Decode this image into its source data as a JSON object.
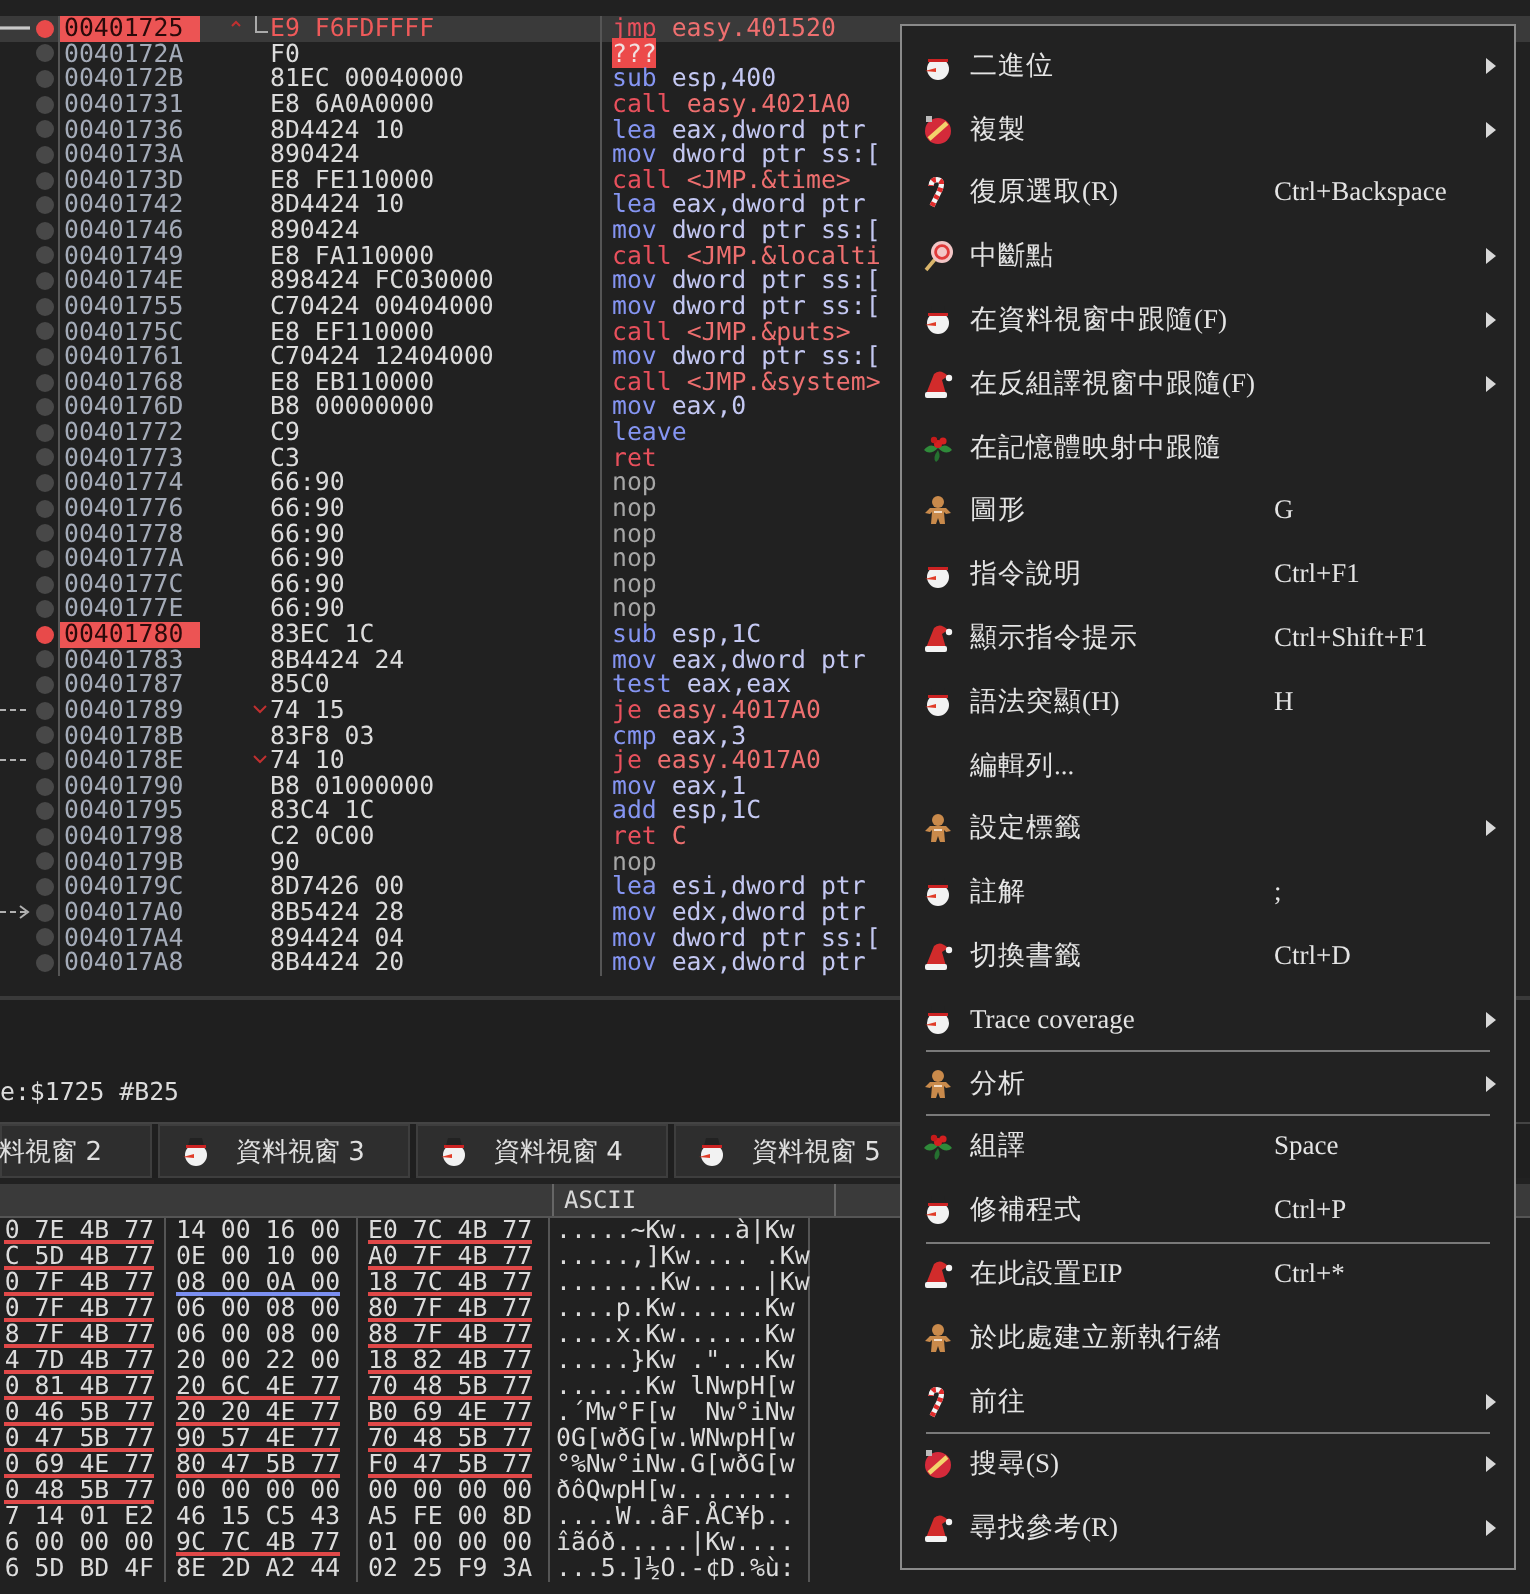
{
  "disassembly": {
    "rows": [
      {
        "address": "00401725",
        "bytes": "E9 F6FDFFFF",
        "mnemonic": "jmp",
        "operands": "easy.401520",
        "kind": "jump",
        "breakpoint": true,
        "selected": true,
        "patched": true,
        "jump_source": true,
        "jump_backward": true,
        "jump_target": false
      },
      {
        "address": "0040172A",
        "bytes": "F0",
        "mnemonic": "???",
        "kind": "invalid",
        "breakpoint": false,
        "selected": false,
        "patched": false,
        "jump_source": false,
        "jump_target": false
      },
      {
        "address": "0040172B",
        "bytes": "81EC 00040000",
        "mnemonic": "sub",
        "operands": "esp,400",
        "kind": "normal",
        "breakpoint": false,
        "selected": false,
        "patched": false,
        "jump_source": false,
        "jump_target": false
      },
      {
        "address": "00401731",
        "bytes": "E8 6A0A0000",
        "mnemonic": "call",
        "operands": "easy.4021A0",
        "kind": "call",
        "breakpoint": false,
        "selected": false,
        "patched": false,
        "jump_source": false,
        "jump_target": false
      },
      {
        "address": "00401736",
        "bytes": "8D4424 10",
        "mnemonic": "lea",
        "operands": "eax,dword ptr",
        "kind": "normal",
        "breakpoint": false,
        "selected": false,
        "patched": false,
        "jump_source": false,
        "jump_target": false
      },
      {
        "address": "0040173A",
        "bytes": "890424",
        "mnemonic": "mov",
        "operands": "dword ptr ss:[",
        "kind": "normal",
        "breakpoint": false,
        "selected": false,
        "patched": false,
        "jump_source": false,
        "jump_target": false
      },
      {
        "address": "0040173D",
        "bytes": "E8 FE110000",
        "mnemonic": "call",
        "operands": "<JMP.&time>",
        "kind": "call",
        "breakpoint": false,
        "selected": false,
        "patched": false,
        "jump_source": false,
        "jump_target": false
      },
      {
        "address": "00401742",
        "bytes": "8D4424 10",
        "mnemonic": "lea",
        "operands": "eax,dword ptr",
        "kind": "normal",
        "breakpoint": false,
        "selected": false,
        "patched": false,
        "jump_source": false,
        "jump_target": false
      },
      {
        "address": "00401746",
        "bytes": "890424",
        "mnemonic": "mov",
        "operands": "dword ptr ss:[",
        "kind": "normal",
        "breakpoint": false,
        "selected": false,
        "patched": false,
        "jump_source": false,
        "jump_target": false
      },
      {
        "address": "00401749",
        "bytes": "E8 FA110000",
        "mnemonic": "call",
        "operands": "<JMP.&localti",
        "kind": "call",
        "breakpoint": false,
        "selected": false,
        "patched": false,
        "jump_source": false,
        "jump_target": false
      },
      {
        "address": "0040174E",
        "bytes": "898424 FC030000",
        "mnemonic": "mov",
        "operands": "dword ptr ss:[",
        "kind": "normal",
        "breakpoint": false,
        "selected": false,
        "patched": false,
        "jump_source": false,
        "jump_target": false
      },
      {
        "address": "00401755",
        "bytes": "C70424 00404000",
        "mnemonic": "mov",
        "operands": "dword ptr ss:[",
        "kind": "normal",
        "breakpoint": false,
        "selected": false,
        "patched": false,
        "jump_source": false,
        "jump_target": false
      },
      {
        "address": "0040175C",
        "bytes": "E8 EF110000",
        "mnemonic": "call",
        "operands": "<JMP.&puts>",
        "kind": "call",
        "breakpoint": false,
        "selected": false,
        "patched": false,
        "jump_source": false,
        "jump_target": false
      },
      {
        "address": "00401761",
        "bytes": "C70424 12404000",
        "mnemonic": "mov",
        "operands": "dword ptr ss:[",
        "kind": "normal",
        "breakpoint": false,
        "selected": false,
        "patched": false,
        "jump_source": false,
        "jump_target": false
      },
      {
        "address": "00401768",
        "bytes": "E8 EB110000",
        "mnemonic": "call",
        "operands": "<JMP.&system>",
        "kind": "call",
        "breakpoint": false,
        "selected": false,
        "patched": false,
        "jump_source": false,
        "jump_target": false
      },
      {
        "address": "0040176D",
        "bytes": "B8 00000000",
        "mnemonic": "mov",
        "operands": "eax,0",
        "kind": "normal",
        "breakpoint": false,
        "selected": false,
        "patched": false,
        "jump_source": false,
        "jump_target": false
      },
      {
        "address": "00401772",
        "bytes": "C9",
        "mnemonic": "leave",
        "kind": "normal",
        "breakpoint": false,
        "selected": false,
        "patched": false,
        "jump_source": false,
        "jump_target": false
      },
      {
        "address": "00401773",
        "bytes": "C3",
        "mnemonic": "ret",
        "kind": "ret",
        "breakpoint": false,
        "selected": false,
        "patched": false,
        "jump_source": false,
        "jump_target": false
      },
      {
        "address": "00401774",
        "bytes": "66:90",
        "mnemonic": "nop",
        "kind": "nop",
        "breakpoint": false,
        "selected": false,
        "patched": false,
        "jump_source": false,
        "jump_target": false
      },
      {
        "address": "00401776",
        "bytes": "66:90",
        "mnemonic": "nop",
        "kind": "nop",
        "breakpoint": false,
        "selected": false,
        "patched": false,
        "jump_source": false,
        "jump_target": false
      },
      {
        "address": "00401778",
        "bytes": "66:90",
        "mnemonic": "nop",
        "kind": "nop",
        "breakpoint": false,
        "selected": false,
        "patched": false,
        "jump_source": false,
        "jump_target": false
      },
      {
        "address": "0040177A",
        "bytes": "66:90",
        "mnemonic": "nop",
        "kind": "nop",
        "breakpoint": false,
        "selected": false,
        "patched": false,
        "jump_source": false,
        "jump_target": false
      },
      {
        "address": "0040177C",
        "bytes": "66:90",
        "mnemonic": "nop",
        "kind": "nop",
        "breakpoint": false,
        "selected": false,
        "patched": false,
        "jump_source": false,
        "jump_target": false
      },
      {
        "address": "0040177E",
        "bytes": "66:90",
        "mnemonic": "nop",
        "kind": "nop",
        "breakpoint": false,
        "selected": false,
        "patched": false,
        "jump_source": false,
        "jump_target": false
      },
      {
        "address": "00401780",
        "bytes": "83EC 1C",
        "mnemonic": "sub",
        "operands": "esp,1C",
        "kind": "normal",
        "breakpoint": true,
        "selected": false,
        "patched": false,
        "jump_source": false,
        "jump_target": false
      },
      {
        "address": "00401783",
        "bytes": "8B4424 24",
        "mnemonic": "mov",
        "operands": "eax,dword ptr",
        "kind": "normal",
        "breakpoint": false,
        "selected": false,
        "patched": false,
        "jump_source": false,
        "jump_target": false
      },
      {
        "address": "00401787",
        "bytes": "85C0",
        "mnemonic": "test",
        "operands": "eax,eax",
        "kind": "normal",
        "breakpoint": false,
        "selected": false,
        "patched": false,
        "jump_source": false,
        "jump_target": false
      },
      {
        "address": "00401789",
        "bytes": "74 15",
        "mnemonic": "je",
        "operands": "easy.4017A0",
        "kind": "jump",
        "breakpoint": false,
        "selected": false,
        "patched": false,
        "jump_source": true,
        "jump_backward": false,
        "jump_target": false
      },
      {
        "address": "0040178B",
        "bytes": "83F8 03",
        "mnemonic": "cmp",
        "operands": "eax,3",
        "kind": "normal",
        "breakpoint": false,
        "selected": false,
        "patched": false,
        "jump_source": false,
        "jump_target": false
      },
      {
        "address": "0040178E",
        "bytes": "74 10",
        "mnemonic": "je",
        "operands": "easy.4017A0",
        "kind": "jump",
        "breakpoint": false,
        "selected": false,
        "patched": false,
        "jump_source": true,
        "jump_backward": false,
        "jump_target": false
      },
      {
        "address": "00401790",
        "bytes": "B8 01000000",
        "mnemonic": "mov",
        "operands": "eax,1",
        "kind": "normal",
        "breakpoint": false,
        "selected": false,
        "patched": false,
        "jump_source": false,
        "jump_target": false
      },
      {
        "address": "00401795",
        "bytes": "83C4 1C",
        "mnemonic": "add",
        "operands": "esp,1C",
        "kind": "normal",
        "breakpoint": false,
        "selected": false,
        "patched": false,
        "jump_source": false,
        "jump_target": false
      },
      {
        "address": "00401798",
        "bytes": "C2 0C00",
        "mnemonic": "ret",
        "operands": "C",
        "kind": "ret",
        "breakpoint": false,
        "selected": false,
        "patched": false,
        "jump_source": false,
        "jump_target": false
      },
      {
        "address": "0040179B",
        "bytes": "90",
        "mnemonic": "nop",
        "kind": "nop",
        "breakpoint": false,
        "selected": false,
        "patched": false,
        "jump_source": false,
        "jump_target": false
      },
      {
        "address": "0040179C",
        "bytes": "8D7426 00",
        "mnemonic": "lea",
        "operands": "esi,dword ptr",
        "kind": "normal",
        "breakpoint": false,
        "selected": false,
        "patched": false,
        "jump_source": false,
        "jump_target": false
      },
      {
        "address": "004017A0",
        "bytes": "8B5424 28",
        "mnemonic": "mov",
        "operands": "edx,dword ptr",
        "kind": "normal",
        "breakpoint": false,
        "selected": false,
        "patched": false,
        "jump_source": false,
        "jump_target": true
      },
      {
        "address": "004017A4",
        "bytes": "894424 04",
        "mnemonic": "mov",
        "operands": "dword ptr ss:[",
        "kind": "normal",
        "breakpoint": false,
        "selected": false,
        "patched": false,
        "jump_source": false,
        "jump_target": false
      },
      {
        "address": "004017A8",
        "bytes": "8B4424 20",
        "mnemonic": "mov",
        "operands": "eax,dword ptr",
        "kind": "normal",
        "breakpoint": false,
        "selected": false,
        "patched": false,
        "jump_source": false,
        "jump_target": false
      }
    ]
  },
  "status_line": "e:$1725 #B25",
  "dump_tabs": [
    {
      "label": "料視窗 2",
      "icon": false
    },
    {
      "label": "資料視窗 3",
      "icon": true
    },
    {
      "label": "資料視窗 4",
      "icon": true
    },
    {
      "label": "資料視窗 5",
      "icon": true
    }
  ],
  "dump": {
    "ascii_header": "ASCII",
    "rows": [
      {
        "cells": [
          {
            "text": "0 7E 4B 77",
            "color": "#e04848"
          },
          {
            "text": "14 00 16 00"
          },
          {
            "text": "E0 7C 4B 77",
            "color": "#e04848"
          }
        ],
        "ascii": ".....~Kw....à|Kw"
      },
      {
        "cells": [
          {
            "text": "C 5D 4B 77",
            "color": "#e04848"
          },
          {
            "text": "0E 00 10 00"
          },
          {
            "text": "A0 7F 4B 77",
            "color": "#e04848"
          }
        ],
        "ascii": ".....,]Kw.... .Kw"
      },
      {
        "cells": [
          {
            "text": "0 7F 4B 77",
            "color": "#e04848"
          },
          {
            "text": "08 00 0A 00",
            "color": "#7b8ff0"
          },
          {
            "text": "18 7C 4B 77",
            "color": "#e04848"
          }
        ],
        "ascii": ".......Kw.....|Kw"
      },
      {
        "cells": [
          {
            "text": "0 7F 4B 77",
            "color": "#e04848"
          },
          {
            "text": "06 00 08 00"
          },
          {
            "text": "80 7F 4B 77",
            "color": "#e04848"
          }
        ],
        "ascii": "....p.Kw......Kw"
      },
      {
        "cells": [
          {
            "text": "8 7F 4B 77",
            "color": "#e04848"
          },
          {
            "text": "06 00 08 00"
          },
          {
            "text": "88 7F 4B 77",
            "color": "#e04848"
          }
        ],
        "ascii": "....x.Kw......Kw"
      },
      {
        "cells": [
          {
            "text": "4 7D 4B 77",
            "color": "#e04848"
          },
          {
            "text": "20 00 22 00"
          },
          {
            "text": "18 82 4B 77",
            "color": "#e04848"
          }
        ],
        "ascii": ".....}Kw .\"...Kw"
      },
      {
        "cells": [
          {
            "text": "0 81 4B 77",
            "color": "#e04848"
          },
          {
            "text": "20 6C 4E 77",
            "color": "#e04848"
          },
          {
            "text": "70 48 5B 77",
            "color": "#e04848"
          }
        ],
        "ascii": "......Kw lNwpH[w"
      },
      {
        "cells": [
          {
            "text": "0 46 5B 77",
            "color": "#e04848"
          },
          {
            "text": "20 20 4E 77",
            "color": "#e04848"
          },
          {
            "text": "B0 69 4E 77",
            "color": "#e04848"
          }
        ],
        "ascii": ".´Mw°F[w  Nw°iNw"
      },
      {
        "cells": [
          {
            "text": "0 47 5B 77",
            "color": "#e04848"
          },
          {
            "text": "90 57 4E 77",
            "color": "#e04848"
          },
          {
            "text": "70 48 5B 77",
            "color": "#e04848"
          }
        ],
        "ascii": "0G[wðG[w.WNwpH[w"
      },
      {
        "cells": [
          {
            "text": "0 69 4E 77",
            "color": "#e04848"
          },
          {
            "text": "80 47 5B 77",
            "color": "#e04848"
          },
          {
            "text": "F0 47 5B 77",
            "color": "#e04848"
          }
        ],
        "ascii": "°%Nw°iNw.G[wðG[w"
      },
      {
        "cells": [
          {
            "text": "0 48 5B 77",
            "color": "#e04848"
          },
          {
            "text": "00 00 00 00"
          },
          {
            "text": "00 00 00 00"
          }
        ],
        "ascii": "ðôQwpH[w........"
      },
      {
        "cells": [
          {
            "text": "7 14 01 E2"
          },
          {
            "text": "46 15 C5 43"
          },
          {
            "text": "A5 FE 00 8D"
          }
        ],
        "ascii": "....W..âF.ÅC¥þ.."
      },
      {
        "cells": [
          {
            "text": "6 00 00 00"
          },
          {
            "text": "9C 7C 4B 77",
            "color": "#e04848"
          },
          {
            "text": "01 00 00 00"
          }
        ],
        "ascii": "îãóð.....|Kw...."
      },
      {
        "cells": [
          {
            "text": "6 5D BD 4F"
          },
          {
            "text": "8E 2D A2 44"
          },
          {
            "text": "02 25 F9 3A"
          }
        ],
        "ascii": "...5.]½O.-¢D.%ù:"
      }
    ]
  },
  "context_menu": {
    "items": [
      {
        "kind": "item",
        "label": "二進位",
        "submenu": true
      },
      {
        "kind": "item",
        "label": "複製",
        "submenu": true
      },
      {
        "kind": "item",
        "label": "復原選取(R)",
        "shortcut": "Ctrl+Backspace",
        "submenu": false
      },
      {
        "kind": "item",
        "label": "中斷點",
        "submenu": true
      },
      {
        "kind": "item",
        "label": "在資料視窗中跟隨(F)",
        "submenu": true
      },
      {
        "kind": "item",
        "label": "在反組譯視窗中跟隨(F)",
        "submenu": true
      },
      {
        "kind": "item",
        "label": "在記憶體映射中跟隨",
        "submenu": false
      },
      {
        "kind": "item",
        "label": "圖形",
        "shortcut": "G",
        "submenu": false
      },
      {
        "kind": "item",
        "label": "指令說明",
        "shortcut": "Ctrl+F1",
        "submenu": false
      },
      {
        "kind": "item",
        "label": "顯示指令提示",
        "shortcut": "Ctrl+Shift+F1",
        "submenu": false
      },
      {
        "kind": "item",
        "label": "語法突顯(H)",
        "shortcut": "H",
        "submenu": false
      },
      {
        "kind": "item",
        "label": "編輯列...",
        "submenu": false
      },
      {
        "kind": "item",
        "label": "設定標籤",
        "submenu": true
      },
      {
        "kind": "item",
        "label": "註解",
        "shortcut": ";",
        "submenu": false
      },
      {
        "kind": "item",
        "label": "切換書籤",
        "shortcut": "Ctrl+D",
        "submenu": false
      },
      {
        "kind": "item",
        "label": "Trace coverage",
        "submenu": true
      },
      {
        "kind": "separator"
      },
      {
        "kind": "item",
        "label": "分析",
        "submenu": true
      },
      {
        "kind": "separator"
      },
      {
        "kind": "item",
        "label": "組譯",
        "shortcut": "Space",
        "submenu": false
      },
      {
        "kind": "item",
        "label": "修補程式",
        "shortcut": "Ctrl+P",
        "submenu": false
      },
      {
        "kind": "separator"
      },
      {
        "kind": "item",
        "label": "在此設置EIP",
        "shortcut": "Ctrl+*",
        "submenu": false
      },
      {
        "kind": "item",
        "label": "於此處建立新執行緒",
        "submenu": false
      },
      {
        "kind": "item",
        "label": "前往",
        "submenu": true
      },
      {
        "kind": "separator"
      },
      {
        "kind": "item",
        "label": "搜尋(S)",
        "submenu": true
      },
      {
        "kind": "item",
        "label": "尋找參考(R)",
        "submenu": true
      }
    ]
  }
}
